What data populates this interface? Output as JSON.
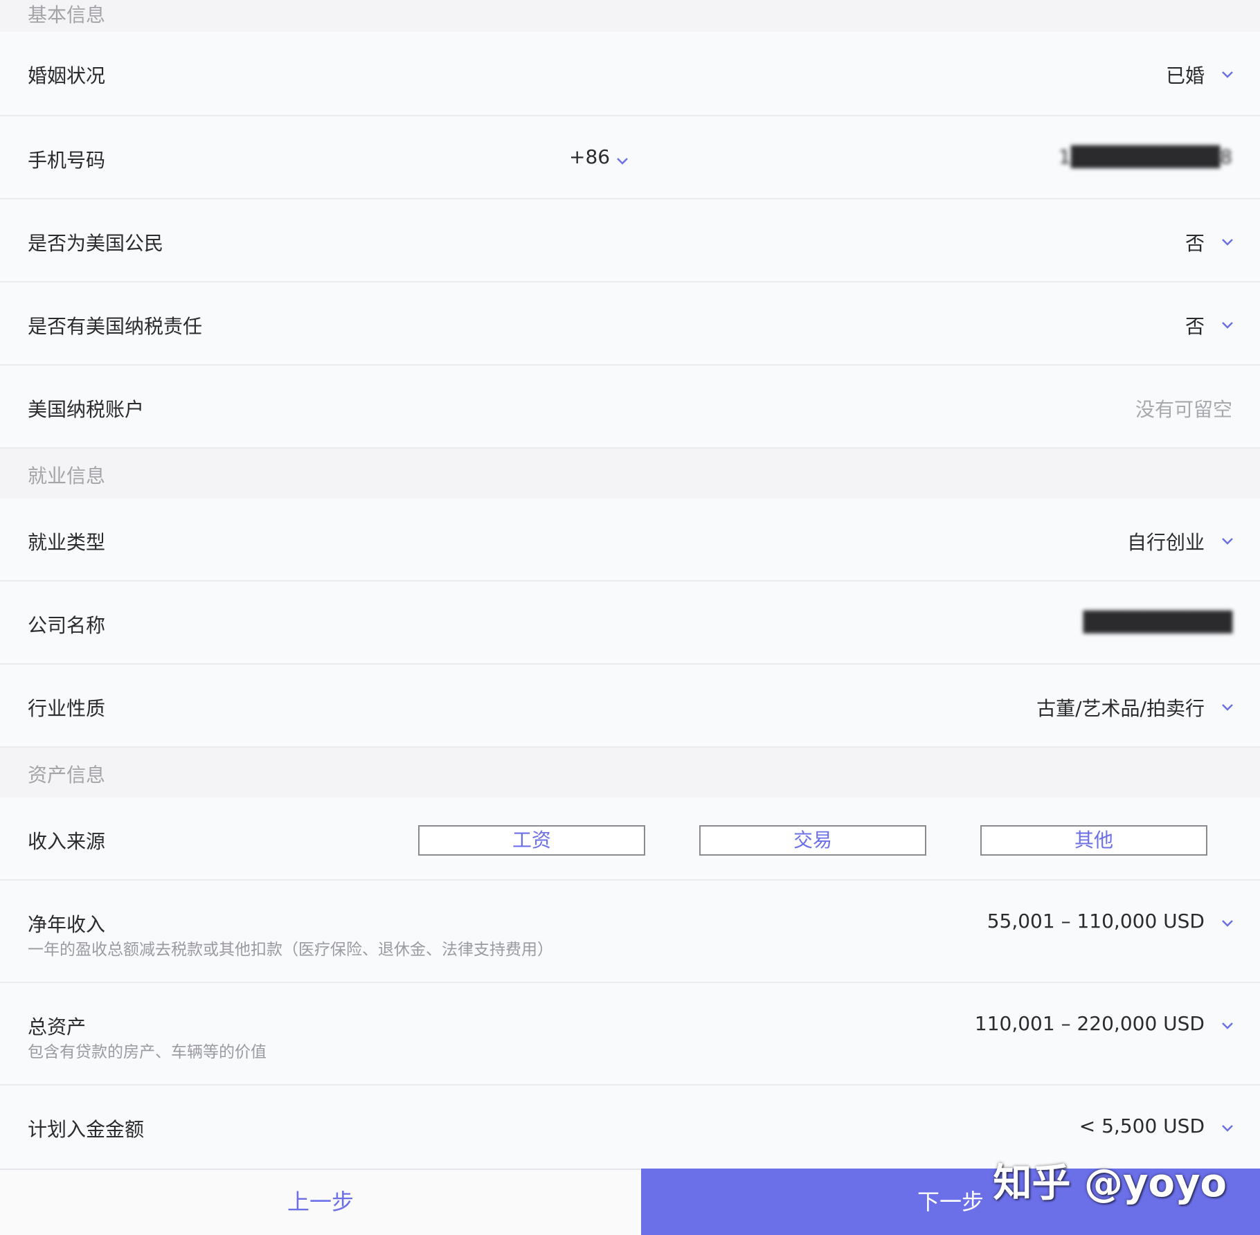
{
  "progress": {
    "fraction": 0.65
  },
  "sections": {
    "basic": "基本信息",
    "employment": "就业信息",
    "assets": "资产信息"
  },
  "fields": {
    "marital": {
      "label": "婚姻状况",
      "value": "已婚"
    },
    "phone": {
      "label": "手机号码",
      "country_code": "+86",
      "value": "1██████████8"
    },
    "us_citizen": {
      "label": "是否为美国公民",
      "value": "否"
    },
    "us_tax": {
      "label": "是否有美国纳税责任",
      "value": "否"
    },
    "us_tax_account": {
      "label": "美国纳税账户",
      "placeholder": "没有可留空"
    },
    "employment_type": {
      "label": "就业类型",
      "value": "自行创业"
    },
    "company_name": {
      "label": "公司名称",
      "value": "██████████"
    },
    "industry": {
      "label": "行业性质",
      "value": "古董/艺术品/拍卖行"
    },
    "income_source": {
      "label": "收入来源",
      "options": [
        "工资",
        "交易",
        "其他"
      ]
    },
    "net_income": {
      "label": "净年收入",
      "hint": "一年的盈收总额减去税款或其他扣款（医疗保险、退休金、法律支持费用）",
      "value": "55,001 – 110,000 USD"
    },
    "total_assets": {
      "label": "总资产",
      "hint": "包含有贷款的房产、车辆等的价值",
      "value": "110,001 – 220,000 USD"
    },
    "deposit": {
      "label": "计划入金金额",
      "value": "< 5,500 USD"
    }
  },
  "footer": {
    "prev": "上一步",
    "next": "下一步"
  },
  "watermark": "知乎 @yoyo",
  "colors": {
    "accent": "#6b6fe8",
    "background": "#f9fafc",
    "section_bg": "#f4f4f6"
  },
  "icons": {
    "dropdown": "chevron-down-icon"
  }
}
